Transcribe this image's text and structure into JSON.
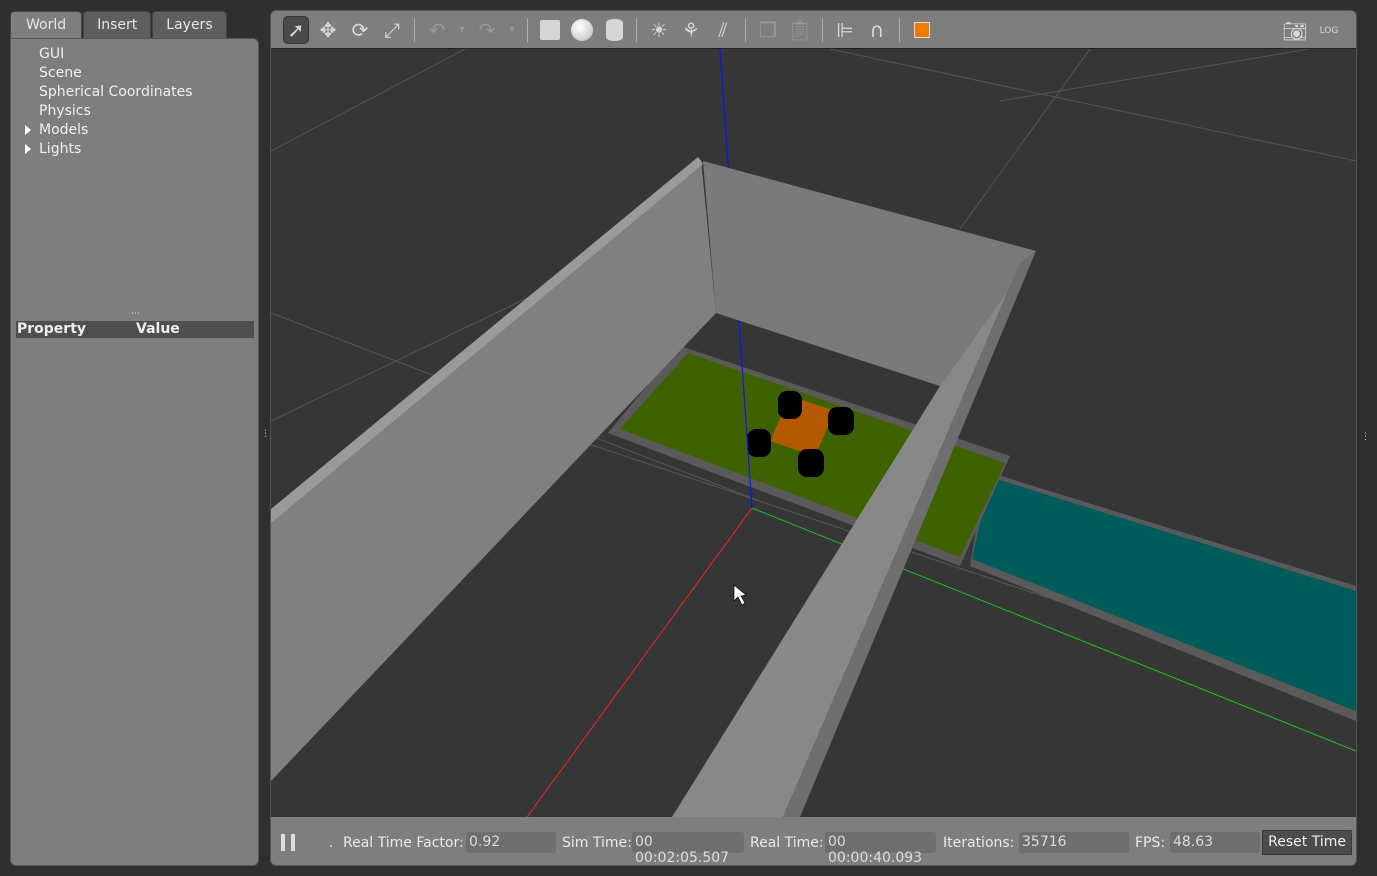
{
  "tabs": [
    {
      "label": "World",
      "active": true
    },
    {
      "label": "Insert"
    },
    {
      "label": "Layers"
    }
  ],
  "tree": [
    {
      "label": "GUI"
    },
    {
      "label": "Scene"
    },
    {
      "label": "Spherical Coordinates"
    },
    {
      "label": "Physics"
    },
    {
      "label": "Models",
      "expandable": true
    },
    {
      "label": "Lights",
      "expandable": true
    }
  ],
  "property_table": {
    "col_property": "Property",
    "col_value": "Value"
  },
  "toolbar": {
    "tools": [
      "select-arrow-icon",
      "translate-icon",
      "rotate-icon",
      "scale-icon",
      "undo-icon",
      "redo-icon",
      "box-icon",
      "sphere-icon",
      "cylinder-icon",
      "point-light-icon",
      "spot-light-icon",
      "directional-light-icon",
      "copy-icon",
      "paste-icon",
      "align-icon",
      "magnet-snap-icon",
      "view-angle-icon"
    ],
    "right": [
      "screenshot-camera-icon",
      "log-icon"
    ],
    "active_tool": "select-arrow-icon",
    "accent": "#f57900"
  },
  "status": {
    "real_time_factor_label": "Real Time Factor:",
    "real_time_factor": "0.92",
    "sim_time_label": "Sim Time:",
    "sim_time": "00 00:02:05.507",
    "real_time_label": "Real Time:",
    "real_time": "00 00:00:40.093",
    "iterations_label": "Iterations:",
    "iterations": "35716",
    "fps_label": "FPS:",
    "fps": "48.63",
    "reset_label": "Reset Time",
    "dot": "."
  },
  "colors": {
    "x_axis": "#ff2020",
    "y_axis": "#20c020",
    "z_axis": "#1010ff",
    "green_mat": "#3e6200",
    "teal_mat": "#005b5b",
    "car_body": "#b35a00"
  }
}
